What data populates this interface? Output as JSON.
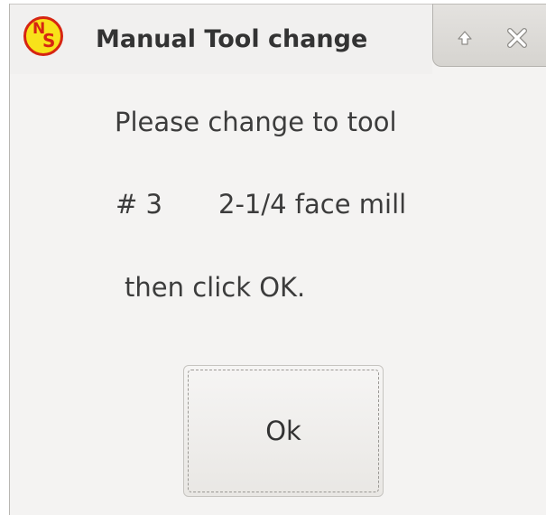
{
  "window": {
    "title": "Manual Tool change",
    "app_icon": {
      "name": "ns-logo-icon",
      "letter_1": "N",
      "letter_2": "S",
      "fill_color": "#f8e21a",
      "ring_color": "#d62512"
    },
    "buttons": {
      "restore_icon": "arrow-up-icon",
      "close_icon": "close-icon"
    }
  },
  "message": {
    "line1": "Please change to tool",
    "tool_number": "# 3",
    "tool_description": "2-1/4 face mill",
    "line3": "then click OK."
  },
  "ok_button": {
    "label": "Ok"
  }
}
